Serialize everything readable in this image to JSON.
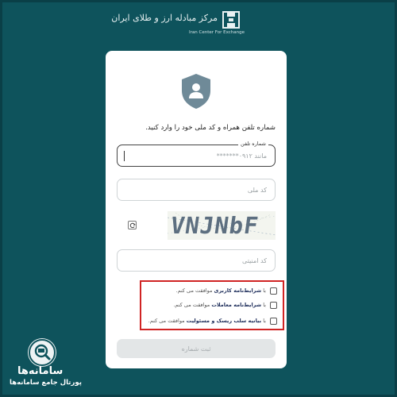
{
  "header": {
    "brand_fa": "مرکز مبادله ارز و طلای ایران",
    "brand_en": "Iran Center For Exchange"
  },
  "form": {
    "instruction": "شماره تلفن همراه و کد ملی خود را وارد کنید.",
    "phone": {
      "label": "شماره تلفن",
      "placeholder": "مانند ۰۹۱۲*******"
    },
    "national_code": {
      "placeholder": "کد ملی"
    },
    "captcha": {
      "text": "VNJNbF",
      "code_placeholder": "کد امنیتی"
    },
    "consents": [
      {
        "prefix": "با",
        "link": "شرایط‌نامه کاربری",
        "suffix": "موافقت می کنم."
      },
      {
        "prefix": "با",
        "link": "شرایط‌نامه معاملات",
        "suffix": "موافقت می کنم."
      },
      {
        "prefix": "با",
        "link": "بیانیه سلب ریسک و مسئولیت",
        "suffix": "موافقت می کنم."
      }
    ],
    "submit_label": "ثبت شماره"
  },
  "watermark": {
    "title": "سامانه‌ها",
    "subtitle": "پورتال جامع سامانه‌ها"
  },
  "colors": {
    "background": "#0e535c",
    "highlight_box": "#d02424",
    "shield": "#6f8a98"
  },
  "icons": [
    "logo-mark-icon",
    "shield-user-icon",
    "refresh-icon",
    "magnifier-monitor-icon"
  ]
}
